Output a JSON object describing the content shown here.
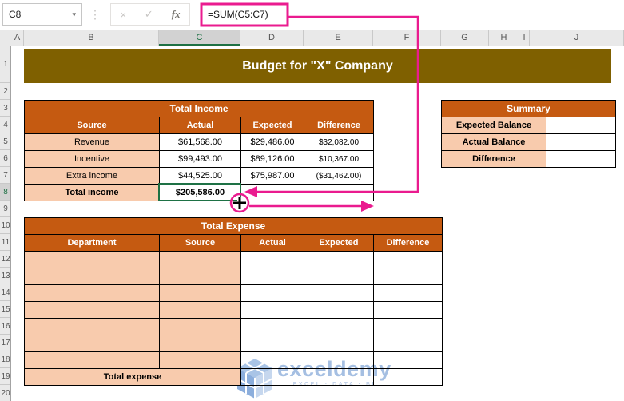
{
  "toolbar": {
    "name_box_value": "C8",
    "cancel_label": "×",
    "enter_label": "✓",
    "fx_label": "fx",
    "dots": "⋮",
    "caret": "▾",
    "formula": "=SUM(C5:C7)"
  },
  "grid": {
    "columns": [
      "A",
      "B",
      "C",
      "D",
      "E",
      "F",
      "G",
      "H",
      "I",
      "J"
    ],
    "rows": [
      "1",
      "2",
      "3",
      "4",
      "5",
      "6",
      "7",
      "8",
      "9",
      "10",
      "11",
      "12",
      "13",
      "14",
      "15",
      "16",
      "17",
      "18",
      "19",
      "20"
    ],
    "selected_column": "C",
    "selected_row": "8"
  },
  "banner": {
    "title": "Budget for \"X\" Company"
  },
  "income_table": {
    "title": "Total Income",
    "headers": [
      "Source",
      "Actual",
      "Expected",
      "Difference"
    ],
    "rows": [
      [
        "Revenue",
        "$61,568.00",
        "$29,486.00",
        "$32,082.00"
      ],
      [
        "Incentive",
        "$99,493.00",
        "$89,126.00",
        "$10,367.00"
      ],
      [
        "Extra income",
        "$44,525.00",
        "$75,987.00",
        "($31,462.00)"
      ]
    ],
    "total_label": "Total income",
    "total_value": "$205,586.00"
  },
  "summary_table": {
    "title": "Summary",
    "row_labels": [
      "Expected Balance",
      "Actual Balance",
      "Difference"
    ]
  },
  "expense_table": {
    "title": "Total Expense",
    "headers": [
      "Department",
      "Source",
      "Actual",
      "Expected",
      "Difference"
    ],
    "empty_row_count": 7,
    "total_label": "Total expense"
  },
  "watermark": {
    "brand": "exceldemy",
    "tagline": "EXCEL · DATA · BI"
  },
  "colors": {
    "header_orange": "#C55A11",
    "cell_peach": "#F8CBAD",
    "banner_olive": "#7F6000",
    "annotation_pink": "#EA1B8F",
    "selection_green": "#1E7145",
    "watermark_blue": "#A5BFE2"
  }
}
